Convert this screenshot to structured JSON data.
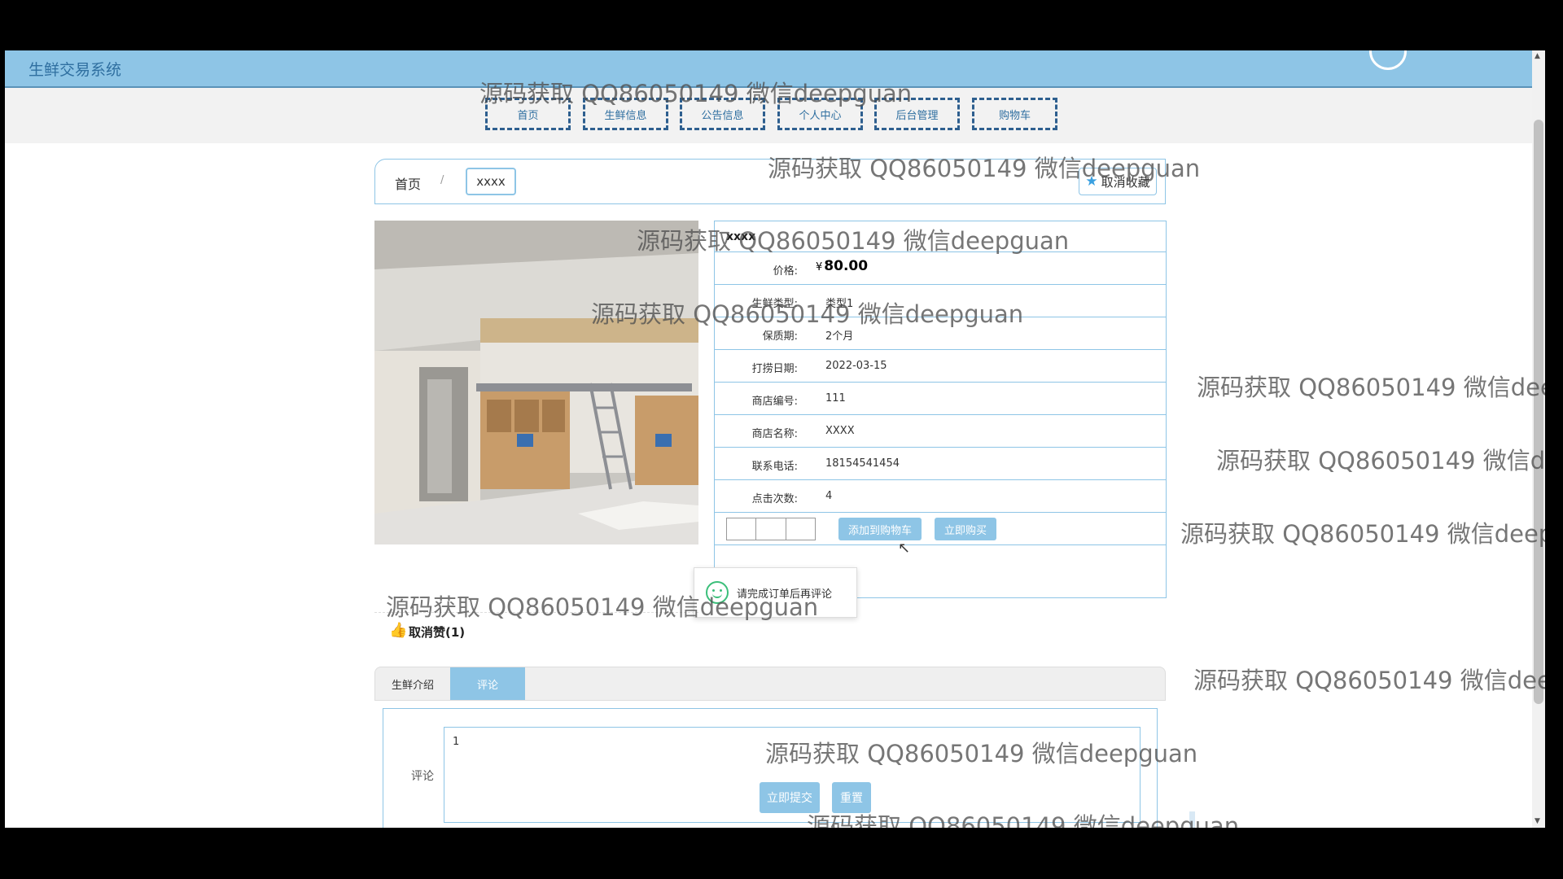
{
  "header": {
    "brand": "生鲜交易系统"
  },
  "nav": {
    "items": [
      "首页",
      "生鲜信息",
      "公告信息",
      "个人中心",
      "后台管理",
      "购物车"
    ]
  },
  "breadcrumb": {
    "home": "首页",
    "separator": "/",
    "current": "xxxx"
  },
  "favorite_button": {
    "label": "取消收藏",
    "icon": "star-icon"
  },
  "product": {
    "title": "xxxx",
    "price": {
      "label": "价格:",
      "currency": "¥",
      "value": "80.00"
    },
    "specs": [
      {
        "label": "生鲜类型:",
        "value": "类型1"
      },
      {
        "label": "保质期:",
        "value": "2个月"
      },
      {
        "label": "打捞日期:",
        "value": "2022-03-15"
      },
      {
        "label": "商店编号:",
        "value": "111"
      },
      {
        "label": "商店名称:",
        "value": "XXXX"
      },
      {
        "label": "联系电话:",
        "value": "18154541454"
      },
      {
        "label": "点击次数:",
        "value": "4"
      }
    ],
    "add_to_cart_label": "添加到购物车",
    "buy_now_label": "立即购买"
  },
  "toast": {
    "text": "请完成订单后再评论",
    "icon": "smile-icon"
  },
  "like": {
    "label": "取消赞(1)",
    "icon": "thumbs-up-icon"
  },
  "tabs": [
    {
      "label": "生鲜介绍",
      "active": false
    },
    {
      "label": "评论",
      "active": true
    }
  ],
  "comment": {
    "label": "评论",
    "value": "1",
    "submit_label": "立即提交",
    "reset_label": "重置"
  },
  "watermark": "源码获取 QQ86050149 微信deepguan",
  "colors": {
    "header_bg": "#8ec5e6",
    "accent": "#8ec5e6",
    "nav_border": "#2e5f8f"
  }
}
